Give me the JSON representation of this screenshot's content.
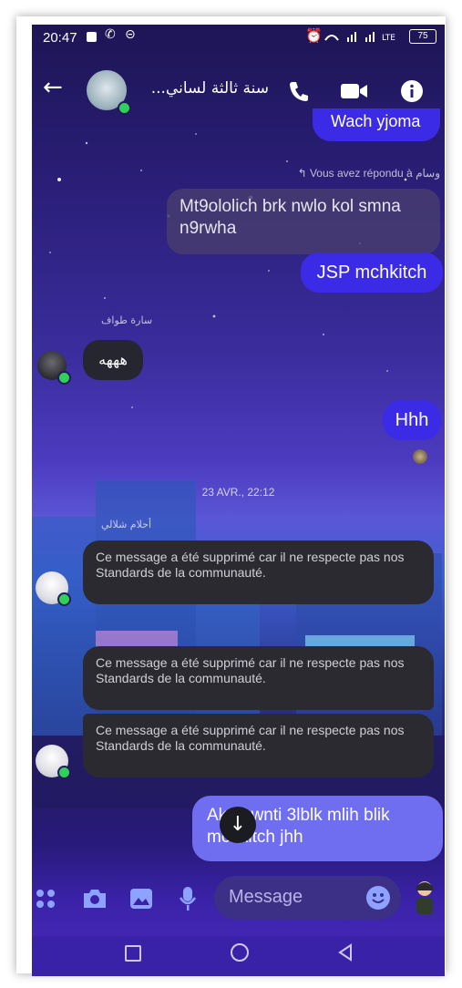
{
  "status": {
    "time": "20:47",
    "battery": "75"
  },
  "header": {
    "title": "سنة ثالثة لساني..."
  },
  "messages": {
    "top_partial": "Wach yjoma",
    "reply_info": "Vous avez répondu à وسام",
    "quoted": "Mt9ololich brk nwlo kol smna n9rwha",
    "out1": "JSP mchkitch",
    "sender1": "سارة طواف",
    "in1": "هههه",
    "out2": "Hhh",
    "timestamp": "23 AVR., 22:12",
    "sender2": "أحلام شلالي",
    "deleted1": "Ce message a été supprimé car il ne respecte pas nos Standards de la communauté.",
    "deleted2": "Ce message a été supprimé car il ne respecte pas nos Standards de la communauté.",
    "deleted3": "Ce message a été supprimé car il ne respecte pas nos Standards de la communauté.",
    "out3": "Aken wnti 3lblk mlih blik mchkitch jhh"
  },
  "composer": {
    "placeholder": "Message"
  },
  "colors": {
    "accent": "#3c2be6",
    "online": "#30d158"
  }
}
